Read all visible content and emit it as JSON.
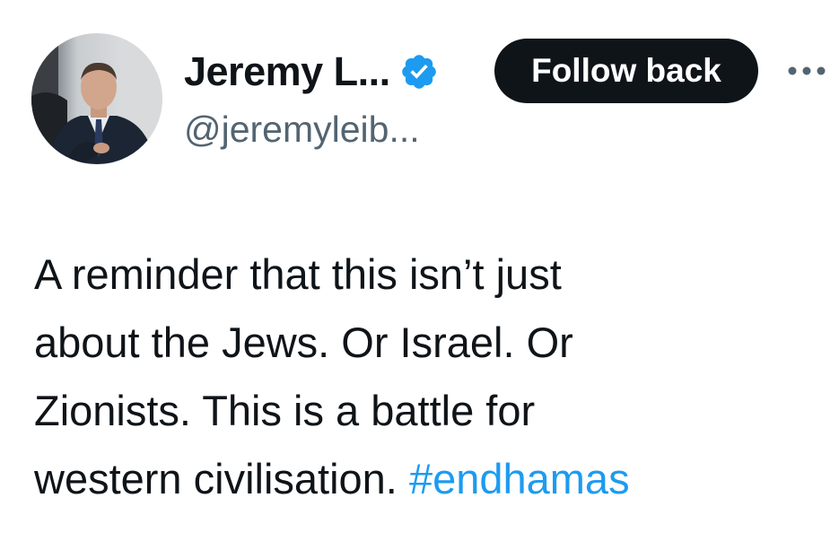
{
  "author": {
    "display_name": "Jeremy L...",
    "handle": "@jeremyleib...",
    "verified": true,
    "verified_badge_color": "#1d9bf0"
  },
  "actions": {
    "follow_label": "Follow back",
    "more_icon": "more-horizontal-icon"
  },
  "tweet": {
    "lines": [
      "A reminder that this isn’t just",
      "about the Jews. Or Israel. Or",
      "Zionists. This is a battle for",
      "western civilisation. "
    ],
    "hashtag": "#endhamas",
    "hashtag_color": "#1d9bf0"
  }
}
